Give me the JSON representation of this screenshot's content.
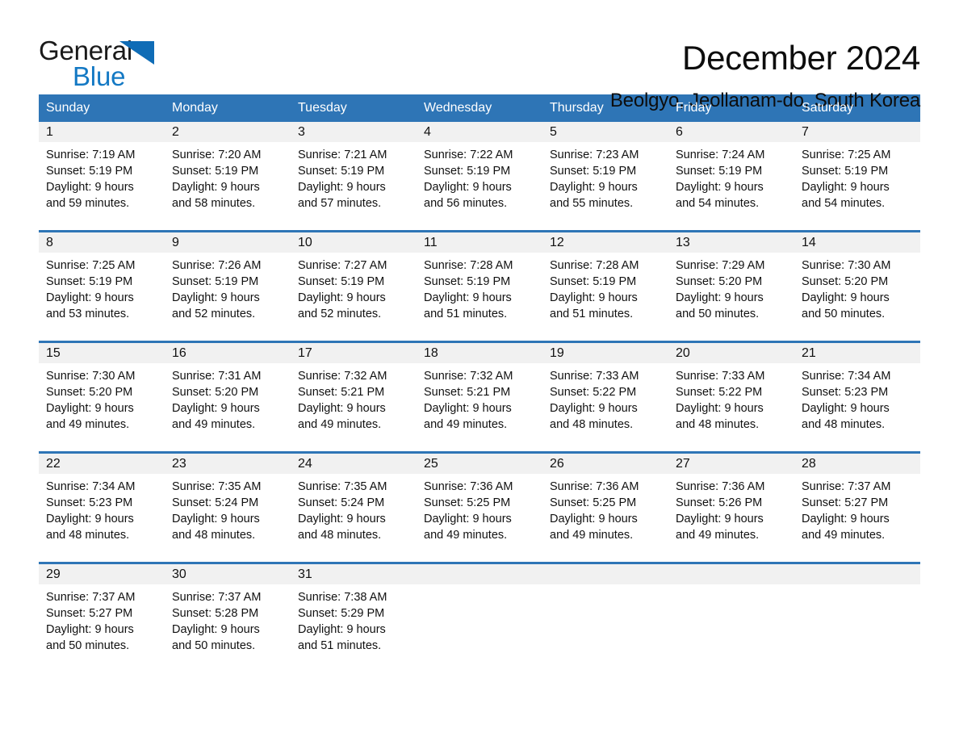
{
  "logo": {
    "word_one": "General",
    "word_two": "Blue",
    "triangle_icon": "blue-triangle-icon",
    "blue": "#0f6cb6"
  },
  "header": {
    "title": "December 2024",
    "subtitle": "Beolgyo, Jeollanam-do, South Korea"
  },
  "colors": {
    "header_blue": "#2e75b6",
    "day_band_gray": "#f1f1f1",
    "logo_blue": "#1479c4"
  },
  "weekdays": [
    "Sunday",
    "Monday",
    "Tuesday",
    "Wednesday",
    "Thursday",
    "Friday",
    "Saturday"
  ],
  "weeks": [
    [
      {
        "day": "1",
        "sunrise": "Sunrise: 7:19 AM",
        "sunset": "Sunset: 5:19 PM",
        "daylight_1": "Daylight: 9 hours",
        "daylight_2": "and 59 minutes."
      },
      {
        "day": "2",
        "sunrise": "Sunrise: 7:20 AM",
        "sunset": "Sunset: 5:19 PM",
        "daylight_1": "Daylight: 9 hours",
        "daylight_2": "and 58 minutes."
      },
      {
        "day": "3",
        "sunrise": "Sunrise: 7:21 AM",
        "sunset": "Sunset: 5:19 PM",
        "daylight_1": "Daylight: 9 hours",
        "daylight_2": "and 57 minutes."
      },
      {
        "day": "4",
        "sunrise": "Sunrise: 7:22 AM",
        "sunset": "Sunset: 5:19 PM",
        "daylight_1": "Daylight: 9 hours",
        "daylight_2": "and 56 minutes."
      },
      {
        "day": "5",
        "sunrise": "Sunrise: 7:23 AM",
        "sunset": "Sunset: 5:19 PM",
        "daylight_1": "Daylight: 9 hours",
        "daylight_2": "and 55 minutes."
      },
      {
        "day": "6",
        "sunrise": "Sunrise: 7:24 AM",
        "sunset": "Sunset: 5:19 PM",
        "daylight_1": "Daylight: 9 hours",
        "daylight_2": "and 54 minutes."
      },
      {
        "day": "7",
        "sunrise": "Sunrise: 7:25 AM",
        "sunset": "Sunset: 5:19 PM",
        "daylight_1": "Daylight: 9 hours",
        "daylight_2": "and 54 minutes."
      }
    ],
    [
      {
        "day": "8",
        "sunrise": "Sunrise: 7:25 AM",
        "sunset": "Sunset: 5:19 PM",
        "daylight_1": "Daylight: 9 hours",
        "daylight_2": "and 53 minutes."
      },
      {
        "day": "9",
        "sunrise": "Sunrise: 7:26 AM",
        "sunset": "Sunset: 5:19 PM",
        "daylight_1": "Daylight: 9 hours",
        "daylight_2": "and 52 minutes."
      },
      {
        "day": "10",
        "sunrise": "Sunrise: 7:27 AM",
        "sunset": "Sunset: 5:19 PM",
        "daylight_1": "Daylight: 9 hours",
        "daylight_2": "and 52 minutes."
      },
      {
        "day": "11",
        "sunrise": "Sunrise: 7:28 AM",
        "sunset": "Sunset: 5:19 PM",
        "daylight_1": "Daylight: 9 hours",
        "daylight_2": "and 51 minutes."
      },
      {
        "day": "12",
        "sunrise": "Sunrise: 7:28 AM",
        "sunset": "Sunset: 5:19 PM",
        "daylight_1": "Daylight: 9 hours",
        "daylight_2": "and 51 minutes."
      },
      {
        "day": "13",
        "sunrise": "Sunrise: 7:29 AM",
        "sunset": "Sunset: 5:20 PM",
        "daylight_1": "Daylight: 9 hours",
        "daylight_2": "and 50 minutes."
      },
      {
        "day": "14",
        "sunrise": "Sunrise: 7:30 AM",
        "sunset": "Sunset: 5:20 PM",
        "daylight_1": "Daylight: 9 hours",
        "daylight_2": "and 50 minutes."
      }
    ],
    [
      {
        "day": "15",
        "sunrise": "Sunrise: 7:30 AM",
        "sunset": "Sunset: 5:20 PM",
        "daylight_1": "Daylight: 9 hours",
        "daylight_2": "and 49 minutes."
      },
      {
        "day": "16",
        "sunrise": "Sunrise: 7:31 AM",
        "sunset": "Sunset: 5:20 PM",
        "daylight_1": "Daylight: 9 hours",
        "daylight_2": "and 49 minutes."
      },
      {
        "day": "17",
        "sunrise": "Sunrise: 7:32 AM",
        "sunset": "Sunset: 5:21 PM",
        "daylight_1": "Daylight: 9 hours",
        "daylight_2": "and 49 minutes."
      },
      {
        "day": "18",
        "sunrise": "Sunrise: 7:32 AM",
        "sunset": "Sunset: 5:21 PM",
        "daylight_1": "Daylight: 9 hours",
        "daylight_2": "and 49 minutes."
      },
      {
        "day": "19",
        "sunrise": "Sunrise: 7:33 AM",
        "sunset": "Sunset: 5:22 PM",
        "daylight_1": "Daylight: 9 hours",
        "daylight_2": "and 48 minutes."
      },
      {
        "day": "20",
        "sunrise": "Sunrise: 7:33 AM",
        "sunset": "Sunset: 5:22 PM",
        "daylight_1": "Daylight: 9 hours",
        "daylight_2": "and 48 minutes."
      },
      {
        "day": "21",
        "sunrise": "Sunrise: 7:34 AM",
        "sunset": "Sunset: 5:23 PM",
        "daylight_1": "Daylight: 9 hours",
        "daylight_2": "and 48 minutes."
      }
    ],
    [
      {
        "day": "22",
        "sunrise": "Sunrise: 7:34 AM",
        "sunset": "Sunset: 5:23 PM",
        "daylight_1": "Daylight: 9 hours",
        "daylight_2": "and 48 minutes."
      },
      {
        "day": "23",
        "sunrise": "Sunrise: 7:35 AM",
        "sunset": "Sunset: 5:24 PM",
        "daylight_1": "Daylight: 9 hours",
        "daylight_2": "and 48 minutes."
      },
      {
        "day": "24",
        "sunrise": "Sunrise: 7:35 AM",
        "sunset": "Sunset: 5:24 PM",
        "daylight_1": "Daylight: 9 hours",
        "daylight_2": "and 48 minutes."
      },
      {
        "day": "25",
        "sunrise": "Sunrise: 7:36 AM",
        "sunset": "Sunset: 5:25 PM",
        "daylight_1": "Daylight: 9 hours",
        "daylight_2": "and 49 minutes."
      },
      {
        "day": "26",
        "sunrise": "Sunrise: 7:36 AM",
        "sunset": "Sunset: 5:25 PM",
        "daylight_1": "Daylight: 9 hours",
        "daylight_2": "and 49 minutes."
      },
      {
        "day": "27",
        "sunrise": "Sunrise: 7:36 AM",
        "sunset": "Sunset: 5:26 PM",
        "daylight_1": "Daylight: 9 hours",
        "daylight_2": "and 49 minutes."
      },
      {
        "day": "28",
        "sunrise": "Sunrise: 7:37 AM",
        "sunset": "Sunset: 5:27 PM",
        "daylight_1": "Daylight: 9 hours",
        "daylight_2": "and 49 minutes."
      }
    ],
    [
      {
        "day": "29",
        "sunrise": "Sunrise: 7:37 AM",
        "sunset": "Sunset: 5:27 PM",
        "daylight_1": "Daylight: 9 hours",
        "daylight_2": "and 50 minutes."
      },
      {
        "day": "30",
        "sunrise": "Sunrise: 7:37 AM",
        "sunset": "Sunset: 5:28 PM",
        "daylight_1": "Daylight: 9 hours",
        "daylight_2": "and 50 minutes."
      },
      {
        "day": "31",
        "sunrise": "Sunrise: 7:38 AM",
        "sunset": "Sunset: 5:29 PM",
        "daylight_1": "Daylight: 9 hours",
        "daylight_2": "and 51 minutes."
      },
      {
        "day": "",
        "sunrise": "",
        "sunset": "",
        "daylight_1": "",
        "daylight_2": ""
      },
      {
        "day": "",
        "sunrise": "",
        "sunset": "",
        "daylight_1": "",
        "daylight_2": ""
      },
      {
        "day": "",
        "sunrise": "",
        "sunset": "",
        "daylight_1": "",
        "daylight_2": ""
      },
      {
        "day": "",
        "sunrise": "",
        "sunset": "",
        "daylight_1": "",
        "daylight_2": ""
      }
    ]
  ]
}
